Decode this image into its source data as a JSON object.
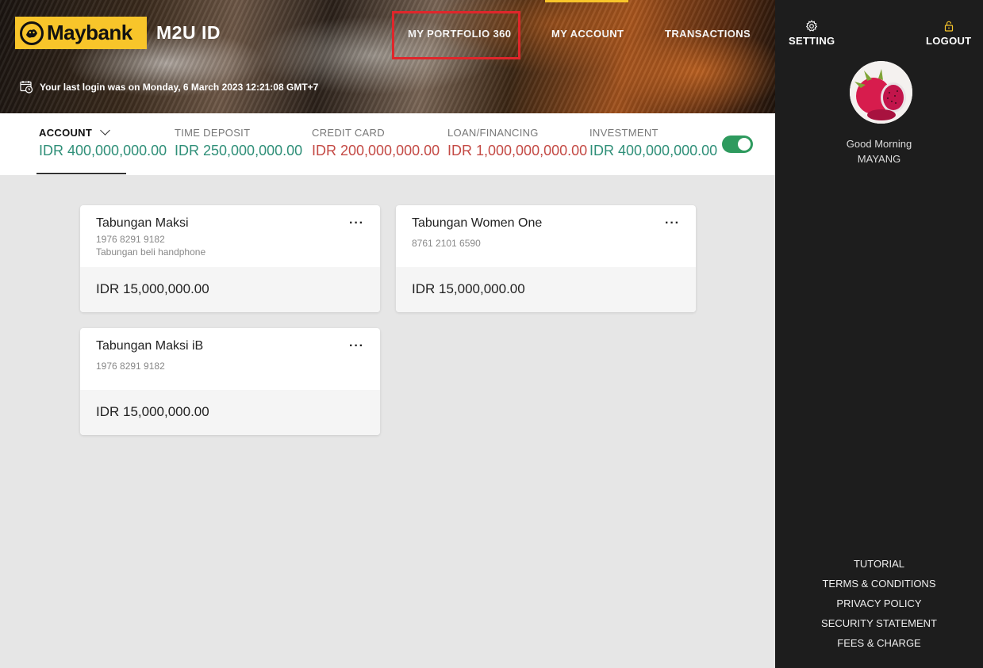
{
  "header": {
    "logo_text": "Maybank",
    "app_title": "M2U ID",
    "nav": [
      {
        "label": "MY PORTFOLIO 360"
      },
      {
        "label": "MY ACCOUNT"
      },
      {
        "label": "TRANSACTIONS"
      }
    ],
    "last_login": "Your last login was on Monday, 6 March 2023 12:21:08 GMT+7"
  },
  "summary": {
    "items": [
      {
        "label": "ACCOUNT",
        "value": "IDR 400,000,000.00"
      },
      {
        "label": "TIME DEPOSIT",
        "value": "IDR 250,000,000.00"
      },
      {
        "label": "CREDIT CARD",
        "value": "IDR 200,000,000.00"
      },
      {
        "label": "LOAN/FINANCING",
        "value": "IDR 1,000,000,000.00"
      },
      {
        "label": "INVESTMENT",
        "value": "IDR 400,000,000.00"
      }
    ],
    "toggle_on": true
  },
  "accounts": [
    {
      "name": "Tabungan Maksi",
      "number": "1976 8291 9182",
      "description": "Tabungan beli handphone",
      "balance": "IDR 15,000,000.00",
      "more": "···"
    },
    {
      "name": "Tabungan Women One",
      "number": "8761 2101 6590",
      "description": "",
      "balance": "IDR 15,000,000.00",
      "more": "···"
    },
    {
      "name": "Tabungan Maksi iB",
      "number": "1976 8291 9182",
      "description": "",
      "balance": "IDR 15,000,000.00",
      "more": "···"
    }
  ],
  "sidebar": {
    "setting_label": "SETTING",
    "logout_label": "LOGOUT",
    "greeting": "Good Morning",
    "username": "MAYANG",
    "links": [
      "TUTORIAL",
      "TERMS & CONDITIONS",
      "PRIVACY POLICY",
      "SECURITY STATEMENT",
      "FEES & CHARGE"
    ]
  },
  "colors": {
    "brand_yellow": "#f8c52a",
    "positive": "#2f8f78",
    "negative": "#c44a45",
    "highlight": "#e0262b",
    "toggle": "#2e9a5e"
  }
}
